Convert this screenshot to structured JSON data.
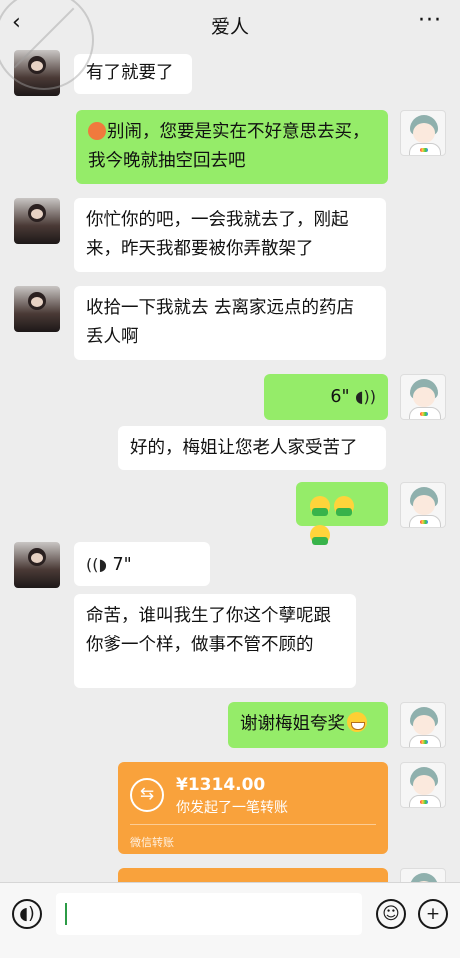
{
  "header": {
    "back_icon": "‹",
    "title": "爱人",
    "more_icon": "···"
  },
  "messages": {
    "m1": "有了就要了",
    "m2": "别闹，您要是实在不好意思去买，我今晚就抽空回去吧",
    "m3": "你忙你的吧，一会我就去了，刚起来，昨天我都要被你弄散架了",
    "m4": "收拾一下我就去 去离家远点的药店 丢人啊",
    "m5_voice": "6\"",
    "m6": "好的，梅姐让您老人家受苦了",
    "m8_voice": "7\"",
    "m9": "命苦，谁叫我生了你这个孽呢跟你爹一个样，做事不管不顾的",
    "m10": "谢谢梅姐夸奖"
  },
  "transfer": {
    "amount": "¥1314.00",
    "desc": "你发起了一笔转账",
    "footer": "微信转账",
    "icon": "⇆"
  },
  "bottom": {
    "voice_icon": "voice-icon",
    "emoji_icon": "emoji-icon",
    "plus_icon": "plus-icon"
  },
  "colors": {
    "my_bubble": "#95ec69",
    "transfer": "#f9a23c",
    "background": "#ededed"
  }
}
